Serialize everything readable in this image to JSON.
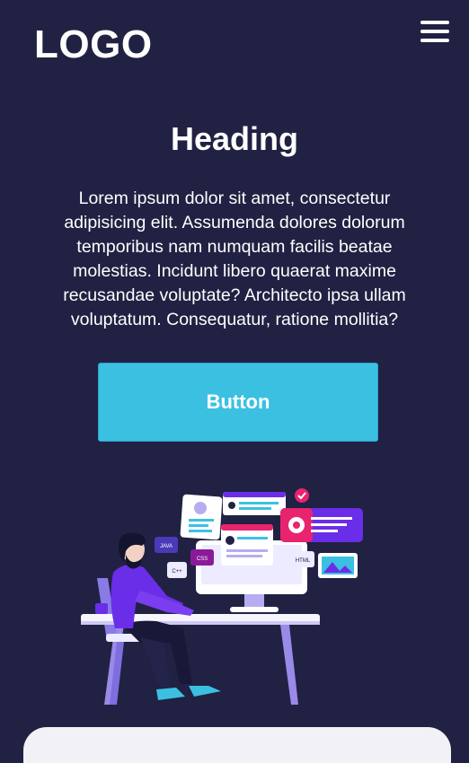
{
  "header": {
    "logo": "LOGO",
    "menu_icon": "hamburger-menu-icon"
  },
  "hero": {
    "heading": "Heading",
    "body": "Lorem ipsum dolor sit amet, consectetur adipisicing elit. Assumenda dolores dolorum temporibus nam numquam facilis beatae molestias. Incidunt libero quaerat maxime recusandae voluptate? Architecto ipsa ullam voluptatum. Consequatur, ratione mollitia?",
    "button_label": "Button"
  },
  "illustration": {
    "badges": {
      "java": "JAVA",
      "cpp": "C++",
      "css": "CSS",
      "html": "HTML"
    }
  },
  "colors": {
    "background": "#212143",
    "button": "#3cc0e2",
    "accent_purple": "#6a2ee8",
    "accent_pink": "#e8246f"
  }
}
